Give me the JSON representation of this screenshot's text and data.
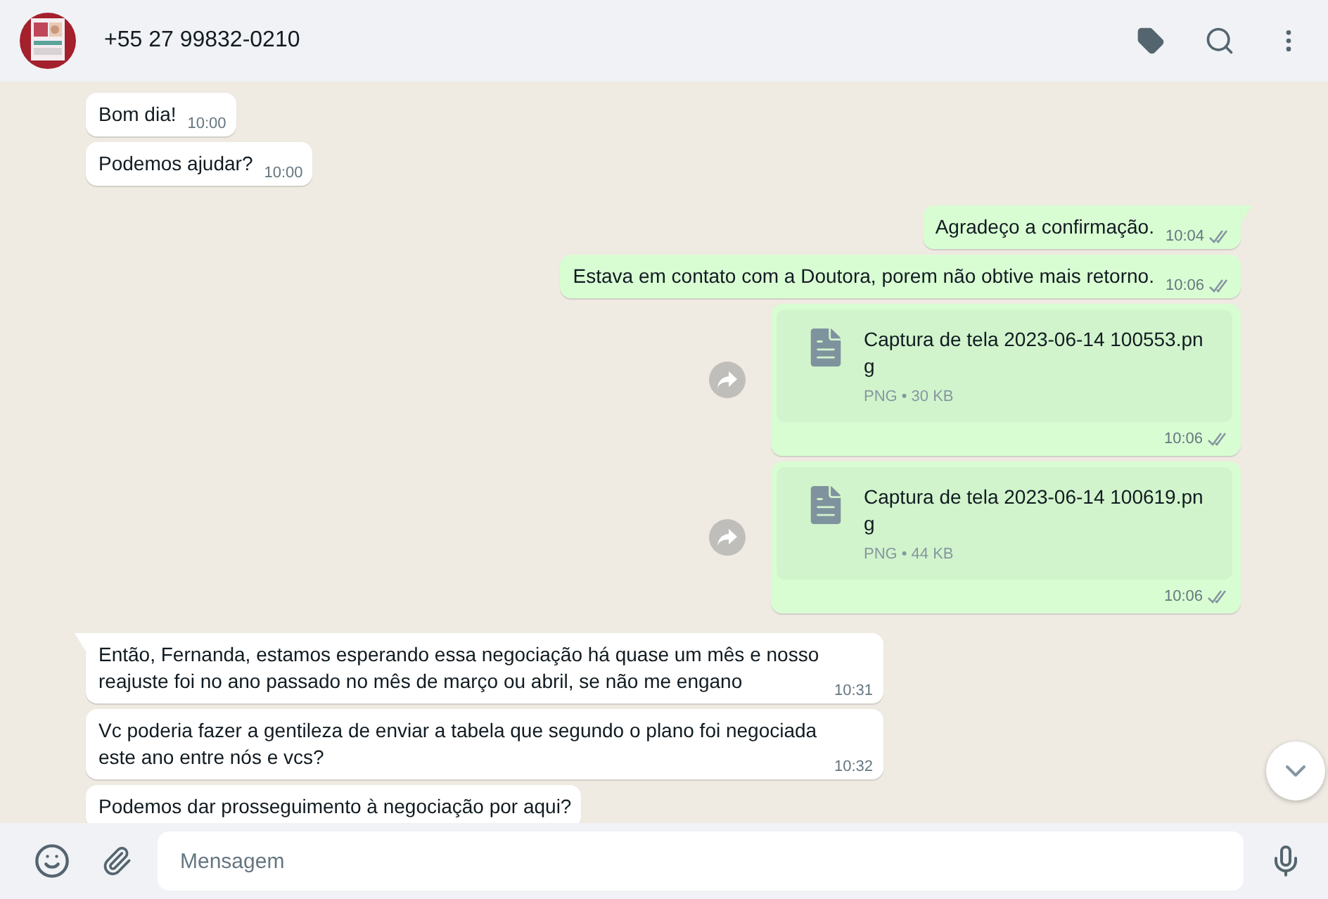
{
  "header": {
    "contact": "+55 27 99832-0210"
  },
  "messages": [
    {
      "kind": "text",
      "outgoing": false,
      "text": "Bom dia!",
      "time": "10:00"
    },
    {
      "kind": "text",
      "outgoing": false,
      "text": "Podemos ajudar?",
      "time": "10:00"
    },
    {
      "kind": "text",
      "outgoing": true,
      "text": "Agradeço a confirmação.",
      "time": "10:04",
      "read": false
    },
    {
      "kind": "text",
      "outgoing": true,
      "text": "Estava em contato com a Doutora, porem não obtive mais retorno.",
      "time": "10:06",
      "read": false
    },
    {
      "kind": "file",
      "outgoing": true,
      "name": "Captura de tela 2023-06-14 100553.png",
      "meta": "PNG • 30 KB",
      "time": "10:06",
      "read": false
    },
    {
      "kind": "file",
      "outgoing": true,
      "name": "Captura de tela 2023-06-14 100619.png",
      "meta": "PNG • 44 KB",
      "time": "10:06",
      "read": false
    },
    {
      "kind": "text",
      "outgoing": false,
      "text": "Então, Fernanda, estamos esperando essa negociação há quase um mês e nosso reajuste foi no ano passado no mês de março ou abril, se não me engano",
      "time": "10:31"
    },
    {
      "kind": "text",
      "outgoing": false,
      "text": "Vc poderia fazer a gentileza de enviar a tabela que segundo o plano foi negociada este ano entre nós e vcs?",
      "time": "10:32"
    },
    {
      "kind": "text",
      "outgoing": false,
      "text": "Podemos dar prosseguimento à negociação por aqui?"
    }
  ],
  "composer": {
    "placeholder": "Mensagem"
  }
}
